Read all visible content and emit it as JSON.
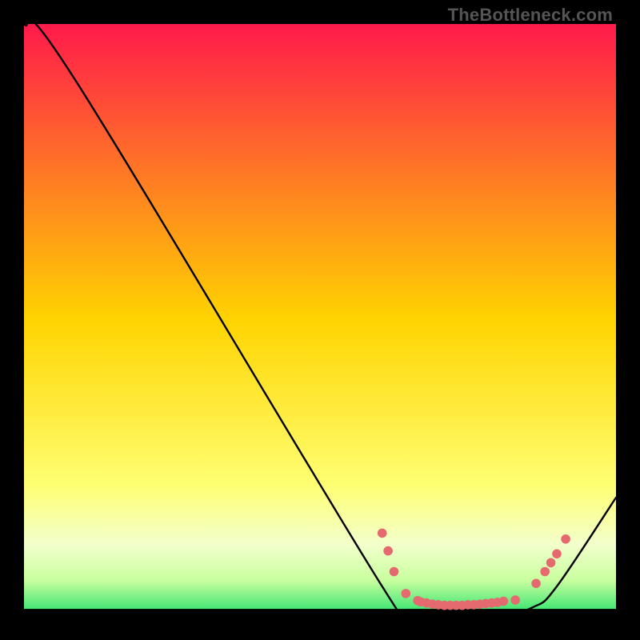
{
  "watermark": "TheBottleneck.com",
  "chart_data": {
    "type": "line",
    "title": "",
    "xlabel": "",
    "ylabel": "",
    "xlim": [
      0,
      100
    ],
    "ylim": [
      0,
      100
    ],
    "gradient_stops": [
      {
        "offset": 0.0,
        "color": "#ff1a4b"
      },
      {
        "offset": 0.5,
        "color": "#ffd400"
      },
      {
        "offset": 0.78,
        "color": "#ffff73"
      },
      {
        "offset": 0.88,
        "color": "#f2ffcc"
      },
      {
        "offset": 0.94,
        "color": "#c8ff9e"
      },
      {
        "offset": 1.0,
        "color": "#26e06b"
      }
    ],
    "curve": [
      {
        "x": 0,
        "y": 100
      },
      {
        "x": 9,
        "y": 90
      },
      {
        "x": 60.5,
        "y": 5
      },
      {
        "x": 65,
        "y": 1
      },
      {
        "x": 70,
        "y": 0
      },
      {
        "x": 80,
        "y": 0
      },
      {
        "x": 86,
        "y": 1.5
      },
      {
        "x": 90,
        "y": 5
      },
      {
        "x": 100,
        "y": 20
      }
    ],
    "dots": [
      {
        "x": 60.5,
        "y": 14
      },
      {
        "x": 61.5,
        "y": 11
      },
      {
        "x": 62.5,
        "y": 7.5
      },
      {
        "x": 64.5,
        "y": 3.8
      },
      {
        "x": 66.5,
        "y": 2.6
      },
      {
        "x": 67.0,
        "y": 2.4
      },
      {
        "x": 68.0,
        "y": 2.2
      },
      {
        "x": 69.0,
        "y": 2.0
      },
      {
        "x": 70.0,
        "y": 1.9
      },
      {
        "x": 71.0,
        "y": 1.8
      },
      {
        "x": 72.0,
        "y": 1.8
      },
      {
        "x": 73.0,
        "y": 1.8
      },
      {
        "x": 74.0,
        "y": 1.8
      },
      {
        "x": 75.0,
        "y": 1.9
      },
      {
        "x": 76.0,
        "y": 1.9
      },
      {
        "x": 77.0,
        "y": 2.0
      },
      {
        "x": 78.0,
        "y": 2.1
      },
      {
        "x": 79.0,
        "y": 2.2
      },
      {
        "x": 80.0,
        "y": 2.3
      },
      {
        "x": 81.0,
        "y": 2.5
      },
      {
        "x": 83.0,
        "y": 2.7
      },
      {
        "x": 86.5,
        "y": 5.5
      },
      {
        "x": 88.0,
        "y": 7.5
      },
      {
        "x": 89.0,
        "y": 9.0
      },
      {
        "x": 90.0,
        "y": 10.5
      },
      {
        "x": 91.5,
        "y": 13.0
      }
    ],
    "dot_color": "#e46a6f",
    "black_overlay_height_pct": 1.2
  }
}
